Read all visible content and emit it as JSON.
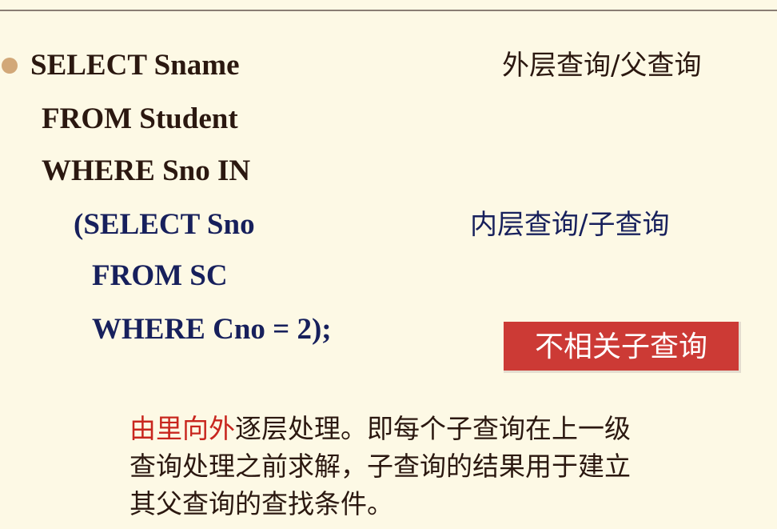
{
  "sql": {
    "outer": [
      "SELECT Sname",
      "FROM Student",
      "WHERE Sno IN"
    ],
    "inner": [
      "(SELECT Sno",
      "FROM SC",
      "WHERE Cno = 2);"
    ]
  },
  "labels": {
    "outer_query": "外层查询/父查询",
    "inner_query": "内层查询/子查询",
    "badge": "不相关子查询"
  },
  "description": {
    "highlight": "由里向外",
    "line1_rest": "逐层处理。即每个子查询在上一级",
    "line2": "查询处理之前求解，子查询的结果用于建立",
    "line3": "其父查询的查找条件。"
  },
  "colors": {
    "background": "#fdf9e5",
    "outer_text": "#2b1810",
    "inner_text": "#17205c",
    "badge": "#cc3a35",
    "highlight": "#c8261e",
    "bullet": "#d2a878"
  }
}
